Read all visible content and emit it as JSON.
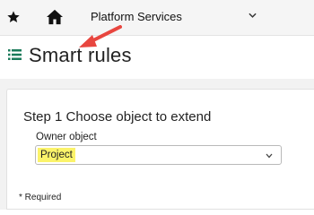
{
  "topbar": {
    "nav_title": "Platform Services",
    "icons": [
      "star-icon",
      "home-icon",
      "chevron-down-icon"
    ]
  },
  "header": {
    "title": "Smart rules",
    "icon": "list-icon"
  },
  "step": {
    "title": "Step 1 Choose object to extend",
    "owner_label": "Owner object",
    "owner_value": "Project"
  },
  "footer": {
    "required_note": "* Required"
  },
  "colors": {
    "highlight": "#fbf36a",
    "annotation_arrow": "#e8463f",
    "list_icon": "#1a7a5a"
  }
}
